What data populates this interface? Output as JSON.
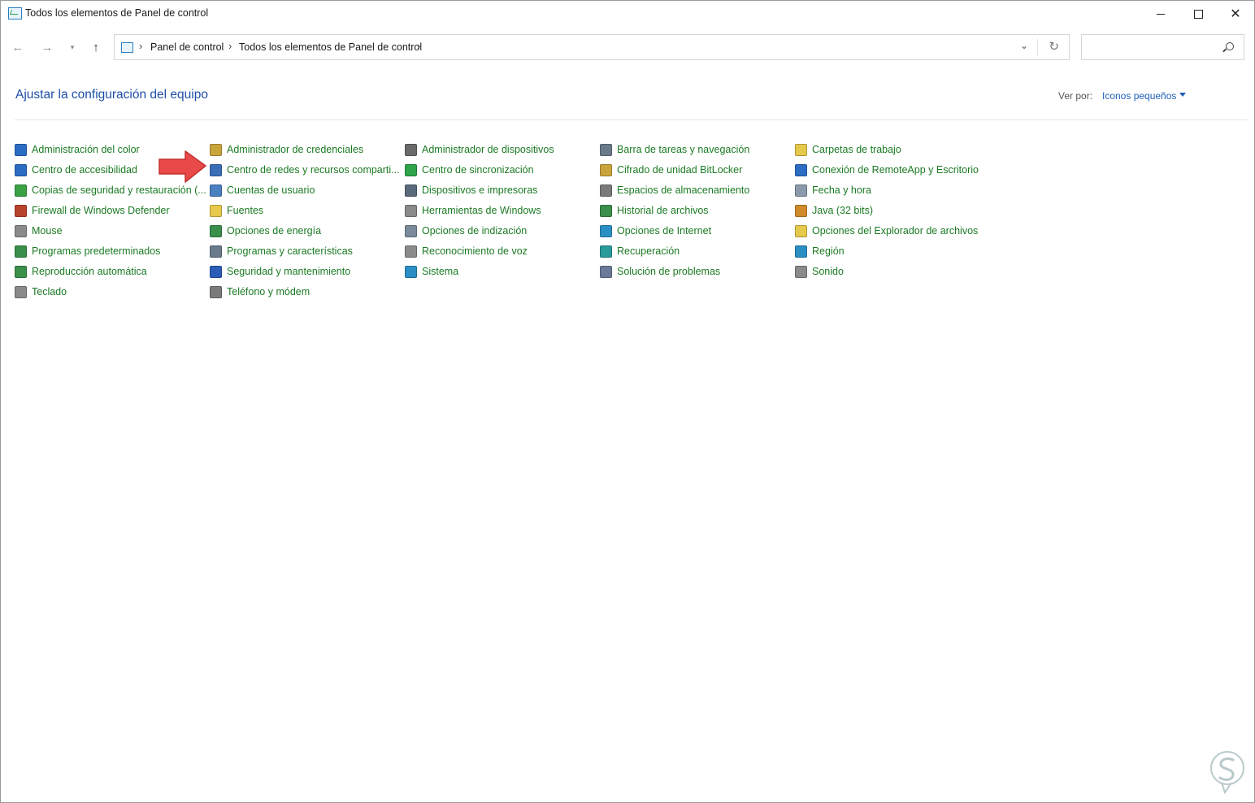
{
  "window": {
    "title": "Todos los elementos de Panel de control"
  },
  "nav": {
    "breadcrumbs": [
      "Panel de control",
      "Todos los elementos de Panel de control"
    ],
    "search_placeholder": ""
  },
  "header": {
    "title": "Ajustar la configuración del equipo",
    "viewby_label": "Ver por:",
    "viewby_value": "Iconos pequeños"
  },
  "columns": [
    {
      "items": [
        {
          "label": "Administración del color",
          "icon": "color-management-icon",
          "color": "#2b6cc4"
        },
        {
          "label": "Centro de accesibilidad",
          "icon": "accessibility-icon",
          "color": "#2b6cc4"
        },
        {
          "label": "Copias de seguridad y restauración (...",
          "icon": "backup-icon",
          "color": "#3aa145"
        },
        {
          "label": "Firewall de Windows Defender",
          "icon": "firewall-icon",
          "color": "#b8432c"
        },
        {
          "label": "Mouse",
          "icon": "mouse-icon",
          "color": "#8a8a8a"
        },
        {
          "label": "Programas predeterminados",
          "icon": "default-programs-icon",
          "color": "#3a8f4a"
        },
        {
          "label": "Reproducción automática",
          "icon": "autoplay-icon",
          "color": "#3a8f4a"
        },
        {
          "label": "Teclado",
          "icon": "keyboard-icon",
          "color": "#8a8a8a"
        }
      ]
    },
    {
      "items": [
        {
          "label": "Administrador de credenciales",
          "icon": "credentials-icon",
          "color": "#c9a43a"
        },
        {
          "label": "Centro de redes y recursos comparti...",
          "icon": "network-icon",
          "color": "#3a6fb8"
        },
        {
          "label": "Cuentas de usuario",
          "icon": "user-accounts-icon",
          "color": "#4a7fc0"
        },
        {
          "label": "Fuentes",
          "icon": "fonts-icon",
          "color": "#e6c84a"
        },
        {
          "label": "Opciones de energía",
          "icon": "power-icon",
          "color": "#3a8f4a"
        },
        {
          "label": "Programas y características",
          "icon": "programs-icon",
          "color": "#6a7a8a"
        },
        {
          "label": "Seguridad y mantenimiento",
          "icon": "flag-icon",
          "color": "#2b5cb8"
        },
        {
          "label": "Teléfono y módem",
          "icon": "phone-modem-icon",
          "color": "#7a7a7a"
        }
      ]
    },
    {
      "items": [
        {
          "label": "Administrador de dispositivos",
          "icon": "device-manager-icon",
          "color": "#6a6a6a"
        },
        {
          "label": "Centro de sincronización",
          "icon": "sync-icon",
          "color": "#2fa34a"
        },
        {
          "label": "Dispositivos e impresoras",
          "icon": "printer-icon",
          "color": "#5a6a7a"
        },
        {
          "label": "Herramientas de Windows",
          "icon": "tools-icon",
          "color": "#8a8a8a"
        },
        {
          "label": "Opciones de indización",
          "icon": "indexing-icon",
          "color": "#7a8a9a"
        },
        {
          "label": "Reconocimiento de voz",
          "icon": "microphone-icon",
          "color": "#8a8a8a"
        },
        {
          "label": "Sistema",
          "icon": "system-icon",
          "color": "#2b8fc4"
        }
      ]
    },
    {
      "items": [
        {
          "label": "Barra de tareas y navegación",
          "icon": "taskbar-icon",
          "color": "#6a7a8a"
        },
        {
          "label": "Cifrado de unidad BitLocker",
          "icon": "bitlocker-icon",
          "color": "#c9a43a"
        },
        {
          "label": "Espacios de almacenamiento",
          "icon": "storage-icon",
          "color": "#7a7a7a"
        },
        {
          "label": "Historial de archivos",
          "icon": "file-history-icon",
          "color": "#3a8f4a"
        },
        {
          "label": "Opciones de Internet",
          "icon": "internet-icon",
          "color": "#2b8fc4"
        },
        {
          "label": "Recuperación",
          "icon": "recovery-icon",
          "color": "#2b9a9a"
        },
        {
          "label": "Solución de problemas",
          "icon": "troubleshoot-icon",
          "color": "#6a7a9a"
        }
      ]
    },
    {
      "items": [
        {
          "label": "Carpetas de trabajo",
          "icon": "work-folders-icon",
          "color": "#e6c84a"
        },
        {
          "label": "Conexión de RemoteApp y Escritorio",
          "icon": "remoteapp-icon",
          "color": "#2b6cc4"
        },
        {
          "label": "Fecha y hora",
          "icon": "date-time-icon",
          "color": "#8a9aaa"
        },
        {
          "label": "Java (32 bits)",
          "icon": "java-icon",
          "color": "#d08a2a"
        },
        {
          "label": "Opciones del Explorador de archivos",
          "icon": "explorer-options-icon",
          "color": "#e6c84a"
        },
        {
          "label": "Región",
          "icon": "region-icon",
          "color": "#2b8fc4"
        },
        {
          "label": "Sonido",
          "icon": "sound-icon",
          "color": "#8a8a8a"
        }
      ]
    }
  ]
}
